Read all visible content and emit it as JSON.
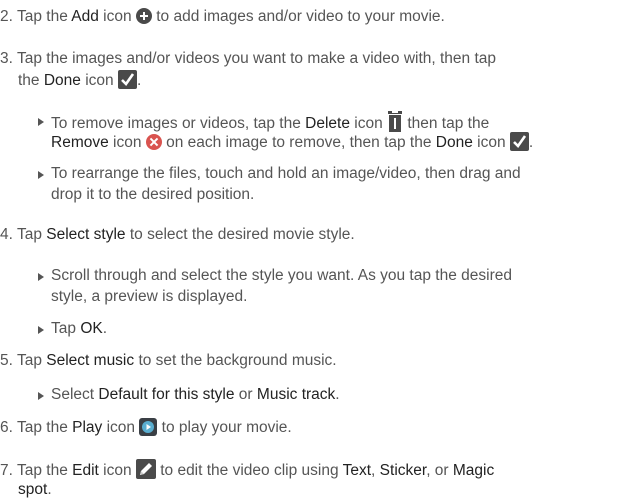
{
  "steps": [
    {
      "num": "2.",
      "pre": " Tap the ",
      "b1": "Add",
      "mid1": " icon ",
      "post": " to add images and/or video to your movie."
    },
    {
      "num": "3.",
      "pre": " Tap the images and/or videos you want to make a video with, then tap",
      "line2a": "the ",
      "b1": "Done",
      "line2b": " icon "
    },
    {
      "num": "4.",
      "pre": " Tap ",
      "b1": "Select style",
      "post": " to select the desired movie style."
    },
    {
      "num": "5.",
      "pre": " Tap ",
      "b1": "Select music",
      "post": " to set the background music."
    },
    {
      "num": "6.",
      "pre": " Tap the ",
      "b1": "Play",
      "mid1": " icon ",
      "post": " to play your movie."
    },
    {
      "num": "7.",
      "pre": " Tap the ",
      "b1": "Edit",
      "mid1": " icon ",
      "post": " to edit the video clip using ",
      "b2": "Text",
      "c1": ", ",
      "b3": "Sticker",
      "c2": ", or ",
      "b4": "Magic",
      "line2": "spot",
      "end": "."
    }
  ],
  "bullets": {
    "remove": {
      "t1": "To remove images or videos, tap the ",
      "b1": "Delete",
      "t2": " icon ",
      "t3": " then tap the",
      "b2": "Remove",
      "t4": " icon ",
      "t5": " on each image to remove, then tap the ",
      "b3": "Done",
      "t6": " icon ",
      "end": "."
    },
    "rearrange": {
      "l1": "To rearrange the files, touch and hold an image/video, then drag and",
      "l2": "drop it to the desired position."
    },
    "scroll": {
      "l1": "Scroll through and select the style you want. As you tap the desired",
      "l2": "style, a preview is displayed."
    },
    "ok": {
      "t1": "Tap ",
      "b1": "OK",
      "end": "."
    },
    "music": {
      "t1": "Select ",
      "b1": "Default for this style",
      "t2": " or ",
      "b2": "Music track",
      "end": "."
    }
  },
  "icons": [
    "add-icon",
    "done-icon",
    "delete-icon",
    "remove-icon",
    "play-icon",
    "edit-icon"
  ],
  "colors": {
    "text": "#555555",
    "emphasis": "#222222",
    "remove": "#d9534f",
    "icon": "#4a4a4a"
  }
}
